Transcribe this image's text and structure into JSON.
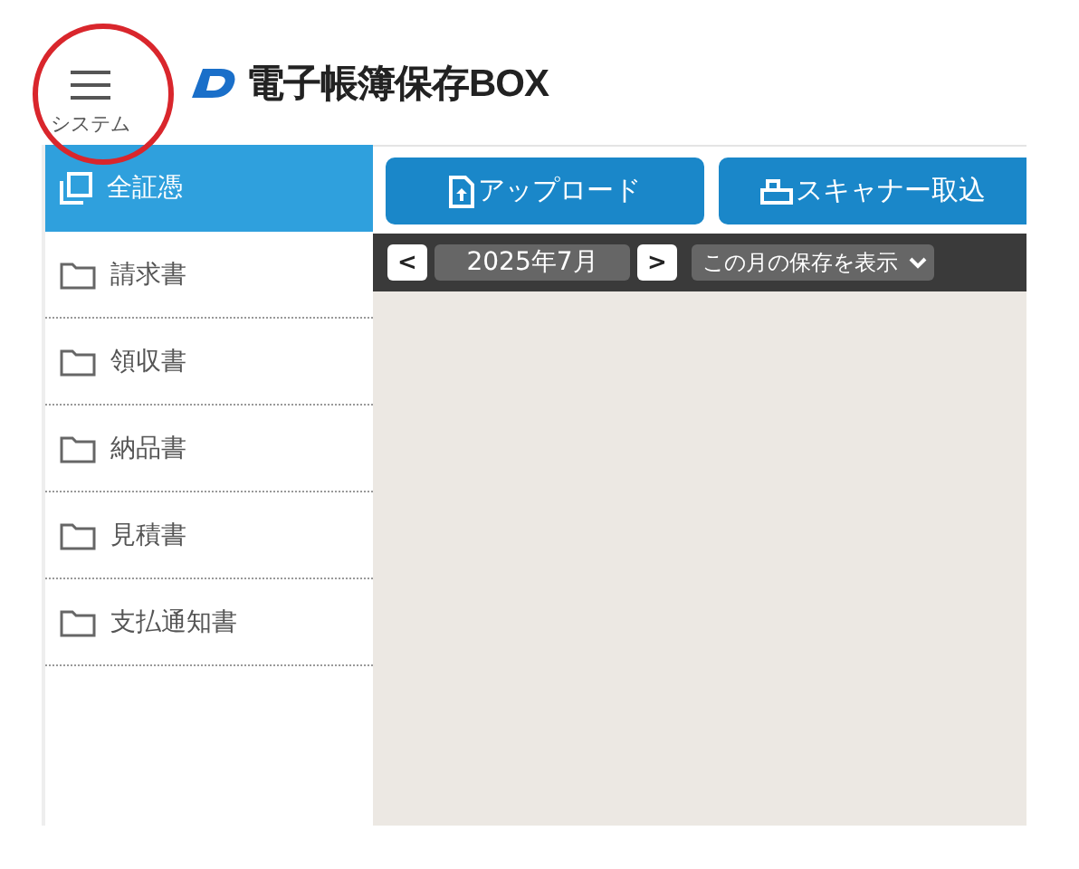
{
  "header": {
    "menu_label": "システム",
    "logo_text": "電子帳簿保存BOX"
  },
  "sidebar": {
    "items": [
      {
        "label": "全証憑",
        "selected": true
      },
      {
        "label": "請求書",
        "selected": false
      },
      {
        "label": "領収書",
        "selected": false
      },
      {
        "label": "納品書",
        "selected": false
      },
      {
        "label": "見積書",
        "selected": false
      },
      {
        "label": "支払通知書",
        "selected": false
      }
    ]
  },
  "toolbar": {
    "buttons": [
      {
        "kind": "upload",
        "label": "アップロード"
      },
      {
        "kind": "scanner",
        "label": "スキャナー取込"
      }
    ]
  },
  "month_bar": {
    "prev": "<",
    "month": "2025年7月",
    "next": ">",
    "filter": "この月の保存を表示"
  }
}
